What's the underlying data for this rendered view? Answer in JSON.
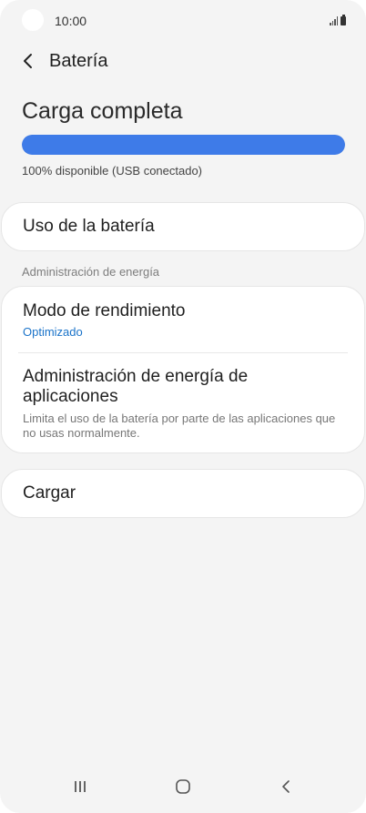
{
  "status_bar": {
    "time": "10:00"
  },
  "header": {
    "back_icon": "chevron-left-icon",
    "title": "Batería"
  },
  "battery": {
    "state_title": "Carga completa",
    "level_fraction": 1.0,
    "availability": "100% disponible (USB conectado)",
    "bar_color": "#3e7be8"
  },
  "usage_card": {
    "label": "Uso de la batería"
  },
  "section": {
    "label": "Administración de energía"
  },
  "management_card": {
    "performance": {
      "title": "Modo de rendimiento",
      "value": "Optimizado"
    },
    "app_power": {
      "title": "Administración de energía de aplicaciones",
      "description": "Limita el uso de la batería por parte de las aplicaciones que no usas normalmente."
    }
  },
  "charge_card": {
    "label": "Cargar"
  },
  "nav_bar": {
    "recents_icon": "recent-apps-icon",
    "home_icon": "home-icon",
    "back_icon": "back-icon"
  },
  "colors": {
    "accent": "#1a73c9",
    "background": "#f4f4f4"
  }
}
